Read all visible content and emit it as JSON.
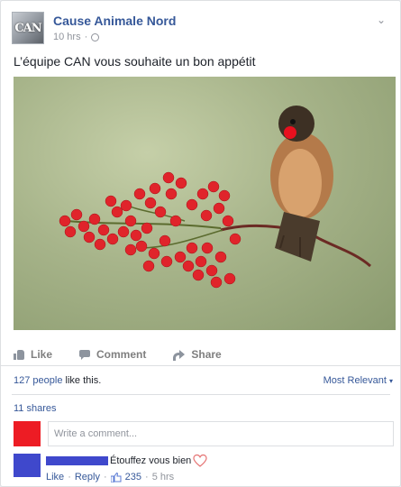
{
  "post": {
    "page_name": "Cause Animale Nord",
    "avatar_text": "CAN",
    "time": "10 hrs",
    "text": "L’équipe CAN vous souhaite un bon appétit"
  },
  "actions": {
    "like": "Like",
    "comment": "Comment",
    "share": "Share"
  },
  "reactions": {
    "count_text": "127 people",
    "suffix": " like this.",
    "sort": "Most Relevant"
  },
  "shares": "11 shares",
  "composer": {
    "placeholder": "Write a comment..."
  },
  "comment": {
    "text": "Étouffez vous bien",
    "like": "Like",
    "reply": "Reply",
    "likes": "235",
    "time": "5 hrs"
  },
  "colors": {
    "link": "#365899",
    "commenter_avatar": "#ed1c24",
    "comment_author_avatar": "#3f48cc",
    "berries": "#e0242b",
    "bird_nose": "#e8101e"
  },
  "icons": [
    "globe-icon",
    "chevron-down-icon",
    "like-icon",
    "comment-icon",
    "share-icon",
    "heart-icon",
    "thumbs-up-icon",
    "sort-caret-icon"
  ]
}
